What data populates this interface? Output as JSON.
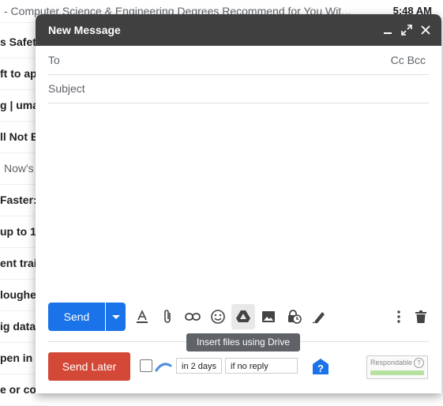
{
  "inbox": {
    "top_subject": "- Computer Science & Engineering Degrees Recommend for You Wit...",
    "top_time": "5:48 AM",
    "rows": [
      {
        "text": "s Safety",
        "bold": true
      },
      {
        "text": "ft to app",
        "bold": true
      },
      {
        "text": "g | uma",
        "bold": true
      },
      {
        "text": "ll Not E",
        "bold": true
      },
      {
        "text": "Now's",
        "bold": false
      },
      {
        "text": "Faster:",
        "bold": true
      },
      {
        "text": "up to 1",
        "bold": true
      },
      {
        "text": "ent trai",
        "bold": true
      },
      {
        "text": "loughe",
        "bold": true
      },
      {
        "text": "ig data",
        "bold": true
      },
      {
        "text": "pen in",
        "bold": true
      },
      {
        "text": "e or co",
        "bold": true
      }
    ]
  },
  "compose": {
    "title": "New Message",
    "to_label": "To",
    "cc_bcc": "Cc Bcc",
    "subject_placeholder": "Subject",
    "send_label": "Send",
    "tooltip": "Insert files using Drive",
    "send_later_label": "Send Later",
    "remind_in": "in 2 days",
    "remind_condition": "if no reply",
    "respondable_label": "Respondable",
    "respondable_help": "?"
  },
  "colors": {
    "header_bg": "#404040",
    "send_blue": "#1a73e8",
    "send_later_red": "#d34836",
    "respondable_green": "#b7e1a1"
  },
  "icons": [
    "minimize-icon",
    "expand-icon",
    "close-icon",
    "format-text-icon",
    "attach-icon",
    "link-icon",
    "emoji-icon",
    "drive-icon",
    "photo-icon",
    "confidential-icon",
    "signature-icon",
    "more-options-icon",
    "trash-icon",
    "help-icon"
  ]
}
